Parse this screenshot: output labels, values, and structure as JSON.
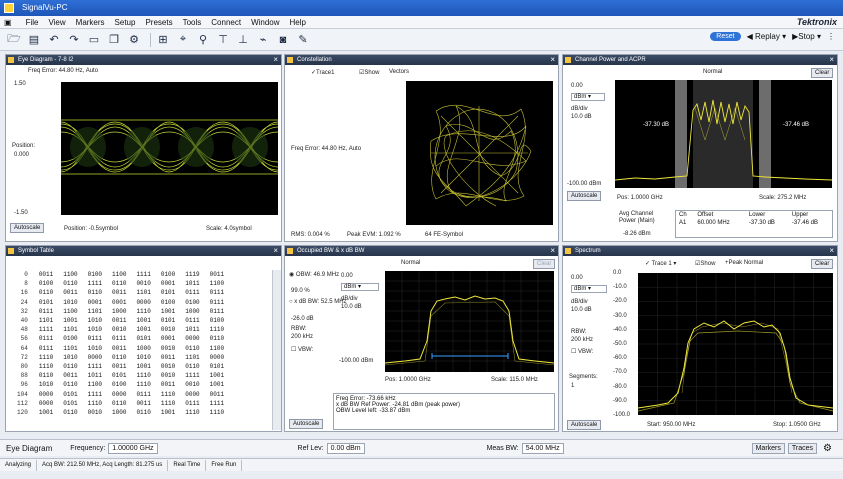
{
  "window": {
    "title": "SignalVu-PC"
  },
  "menu": [
    "File",
    "View",
    "Markers",
    "Setup",
    "Presets",
    "Tools",
    "Connect",
    "Window",
    "Help"
  ],
  "brand": "Tektronix",
  "toolbar": {
    "reset": "Reset",
    "replay": "Replay",
    "stop": "Stop"
  },
  "eye": {
    "title": "Eye Diagram - 7-8 I2",
    "header_text": "Freq Error: 44.80 Hz, Auto",
    "ytop": "1.50",
    "position_label": "Position:",
    "position_value": "0.000",
    "ybottom": "-1.50",
    "autoscale": "Autoscale",
    "xposition": "Position: -0.5symbol",
    "xscale": "Scale: 4.0symbol"
  },
  "const": {
    "title": "Constellation",
    "trace": "Trace1",
    "show": "Show",
    "vectors": "Vectors",
    "freq": "Freq Error: 44.80 Hz, Auto",
    "rms": "RMS: 0.004 %",
    "peak": "Peak EVM: 1.092 %",
    "sym": "64 FE-Symbol"
  },
  "acp": {
    "title": "Channel Power and ACPR",
    "ref": "0.00",
    "unit": "dBm",
    "div_label": "dB/div",
    "div": "10.0 dB",
    "mode": "Normal",
    "clear": "Clear",
    "bottom_ref": "-100.00 dBm",
    "left_label": "-37.30 dB",
    "right_label": "-37.46 dB",
    "autoscale": "Autoscale",
    "pos": "Pos: 1.0000 GHz",
    "scale": "Scale: 275.2 MHz",
    "avg_label": "Avg Channel Power (Main)",
    "avg_value": "-8.26 dBm",
    "tbl_head": [
      "Ch",
      "Offset",
      "Lower",
      "Upper"
    ],
    "tbl_row": [
      "A1",
      "60.000 MHz",
      "-37.30 dB",
      "-37.46 dB"
    ]
  },
  "symtable": {
    "title": "Symbol Table",
    "rows": [
      [
        "0",
        "0011",
        "1100",
        "0100",
        "1100",
        "1111",
        "0100",
        "1119",
        "0011"
      ],
      [
        "8",
        "0100",
        "0110",
        "1111",
        "0110",
        "0010",
        "0001",
        "1011",
        "1100"
      ],
      [
        "16",
        "0110",
        "0011",
        "0110",
        "0011",
        "1101",
        "0101",
        "0111",
        "0111"
      ],
      [
        "24",
        "0101",
        "1010",
        "0001",
        "0001",
        "0000",
        "0100",
        "0100",
        "0111"
      ],
      [
        "32",
        "0111",
        "1100",
        "1101",
        "1000",
        "1110",
        "1001",
        "1000",
        "0111"
      ],
      [
        "40",
        "1101",
        "1001",
        "1010",
        "0011",
        "1001",
        "0101",
        "0111",
        "0100"
      ],
      [
        "48",
        "1111",
        "1101",
        "1010",
        "0010",
        "1001",
        "0010",
        "1011",
        "1110"
      ],
      [
        "56",
        "0111",
        "0100",
        "0111",
        "0111",
        "0101",
        "0001",
        "0000",
        "0110"
      ],
      [
        "64",
        "0111",
        "1101",
        "1010",
        "0011",
        "1000",
        "0010",
        "0110",
        "1100"
      ],
      [
        "72",
        "1110",
        "1010",
        "0000",
        "0110",
        "1010",
        "0011",
        "1101",
        "0000"
      ],
      [
        "80",
        "1110",
        "0110",
        "1111",
        "0011",
        "1001",
        "0010",
        "0110",
        "0101"
      ],
      [
        "88",
        "0110",
        "0011",
        "1011",
        "0101",
        "1110",
        "0010",
        "1111",
        "1001"
      ],
      [
        "96",
        "1010",
        "0110",
        "1100",
        "0100",
        "1110",
        "0011",
        "0010",
        "1001"
      ],
      [
        "104",
        "0000",
        "0101",
        "1111",
        "0000",
        "0111",
        "1110",
        "0000",
        "0011"
      ],
      [
        "112",
        "0000",
        "0101",
        "1110",
        "0110",
        "0011",
        "1110",
        "0111",
        "1111"
      ],
      [
        "120",
        "1001",
        "0110",
        "0010",
        "1000",
        "0110",
        "1001",
        "1110",
        "1110"
      ]
    ]
  },
  "obw": {
    "title": "Occupied BW & x dB BW",
    "r1": "OBW: 46.9 MHz",
    "r2": "99.0 %",
    "r3": "x dB BW: 52.5 MHz",
    "r4": "-26.0 dB",
    "r5": "RBW:",
    "r6": "200 kHz",
    "r7": "VBW:",
    "ref": "0.00",
    "unit": "dBm",
    "div_label": "dB/div",
    "div": "10.0 dB",
    "mode": "Normal",
    "clear": "Clear",
    "bottom_ref": "-100.00 dBm",
    "autoscale": "Autoscale",
    "pos": "Pos: 1.0000 GHz",
    "scale": "Scale: 115.0 MHz",
    "m1": "Freq Error: -73.66 kHz",
    "m2": "x dB BW Ref Power: -24.81 dBm (peak power)",
    "m3": "OBW Level left: -33.87 dBm"
  },
  "spec": {
    "title": "Spectrum",
    "trace": "Trace 1",
    "show": "Show",
    "detect": "+Peak Normal",
    "clear": "Clear",
    "ref": "0.00",
    "unit": "dBm",
    "div_label": "dB/div",
    "div": "10.0 dB",
    "rbw_label": "RBW:",
    "rbw": "200 kHz",
    "vbw": "VBW:",
    "segments": "Segments:",
    "seg_val": "1",
    "ticks": [
      "0.0",
      "-10.0",
      "-20.0",
      "-30.0",
      "-40.0",
      "-50.0",
      "-60.0",
      "-70.0",
      "-80.0",
      "-90.0",
      "-100.0"
    ],
    "autoscale": "Autoscale",
    "start": "Start: 950.00 MHz",
    "stop": "Stop: 1.0500 GHz"
  },
  "bottom": {
    "display": "Eye Diagram",
    "freq_label": "Frequency:",
    "freq": "1.00000 GHz",
    "ref_label": "Ref Lev:",
    "ref": "0.00 dBm",
    "meas_label": "Meas BW:",
    "meas": "54.00 MHz",
    "markers": "Markers",
    "traces": "Traces"
  },
  "status": [
    "Analyzing",
    "Acq BW: 212.50 MHz, Acq Length: 81.275 us",
    "Real Time",
    "Free Run"
  ]
}
